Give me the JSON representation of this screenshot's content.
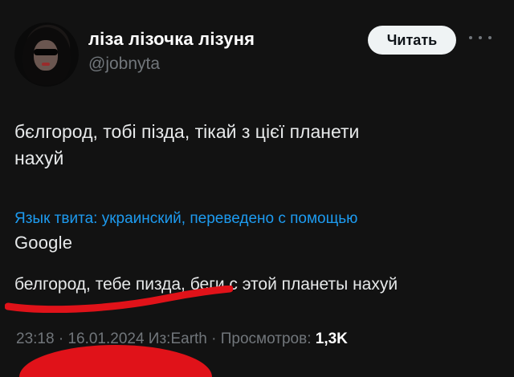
{
  "author": {
    "display_name": "ліза лізочка лізуня",
    "handle": "@jobnyta"
  },
  "follow_label": "Читать",
  "tweet_text_line1": "бєлгород, тобі пізда, тікай з цієї планети",
  "tweet_text_line2": "нахуй",
  "translation": {
    "label": "Язык твита: украинский, переведено с помощью",
    "provider": "Google",
    "text": "белгород, тебе пизда, беги с этой планеты нахуй"
  },
  "meta": {
    "time": "23:18",
    "sep1": " · ",
    "date": "16.01.2024",
    "source": " Из:Earth",
    "sep2": " · ",
    "views_label": "Просмотров: ",
    "views_count": "1,3K"
  },
  "colors": {
    "background": "#121212",
    "link": "#1d9bf0",
    "annotation_red": "#e01219"
  },
  "icons": {
    "more": "more-horizontal-icon"
  }
}
